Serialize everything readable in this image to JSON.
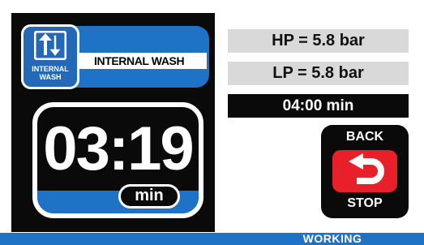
{
  "program": {
    "icon": "internal-wash-icon",
    "icon_line1": "INTERNAL",
    "icon_line2": "WASH",
    "label": "INTERNAL WASH"
  },
  "timer": {
    "value": "03:19",
    "unit": "min"
  },
  "pressures": {
    "hp": "HP = 5.8 bar",
    "lp": "LP = 5.8 bar"
  },
  "set_time": "04:00 min",
  "back_stop": {
    "top_label": "BACK",
    "bottom_label": "STOP",
    "icon": "return-arrow-icon"
  },
  "status": "WORKING",
  "colors": {
    "accent_blue": "#1f73c6",
    "stop_red": "#e8202a",
    "panel_black": "#0a0a0a",
    "info_gray": "#d9d9d9"
  }
}
